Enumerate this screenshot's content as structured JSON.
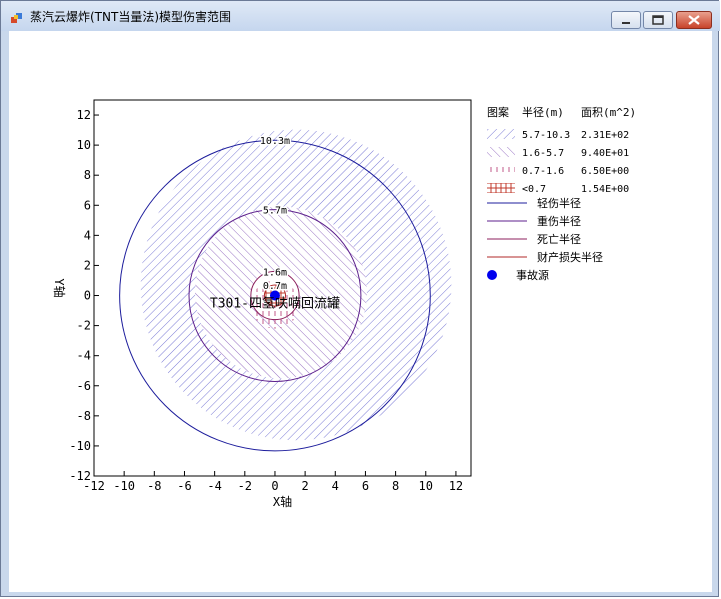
{
  "window": {
    "title": "蒸汽云爆炸(TNT当量法)模型伤害范围",
    "controls": [
      "minimize-icon",
      "maximize-icon",
      "close-icon"
    ]
  },
  "chart_data": {
    "type": "scatter",
    "xlabel": "X轴",
    "ylabel": "Y轴",
    "xlim": [
      -12,
      13
    ],
    "ylim": [
      -12,
      13
    ],
    "xticks": [
      "-12",
      "-10",
      "-8",
      "-6",
      "-4",
      "-2",
      "0",
      "2",
      "4",
      "6",
      "8",
      "10",
      "12"
    ],
    "yticks": [
      "12",
      "10",
      "8",
      "6",
      "4",
      "2",
      "0",
      "-2",
      "-4",
      "-6",
      "-8",
      "-10",
      "-12"
    ],
    "grid": false,
    "legend_position": "right",
    "circles": [
      {
        "radius": 10.3,
        "label": "10.3m",
        "series": "轻伤半径"
      },
      {
        "radius": 5.7,
        "label": "5.7m",
        "series": "重伤半径"
      },
      {
        "radius": 1.6,
        "label": "1.6m",
        "series": "死亡半径"
      },
      {
        "radius": 0.7,
        "label": "0.7m",
        "series": "财产损失半径"
      }
    ],
    "source": {
      "x": 0,
      "y": 0,
      "label": "T301-四氢呋喃回流罐"
    },
    "legend": {
      "headers": [
        "图案",
        "半径(m)",
        "面积(m^2)"
      ],
      "area_rows": [
        {
          "range": "5.7-10.3",
          "area": "2.31E+02",
          "pattern": "diag-right"
        },
        {
          "range": "1.6-5.7",
          "area": "9.40E+01",
          "pattern": "diag-left"
        },
        {
          "range": "0.7-1.6",
          "area": "6.50E+00",
          "pattern": "vertical"
        },
        {
          "range": "<0.7",
          "area": "1.54E+00",
          "pattern": "cross"
        }
      ],
      "line_rows": [
        {
          "label": "轻伤半径",
          "color": "#1c1c9c"
        },
        {
          "label": "重伤半径",
          "color": "#5c1f8c"
        },
        {
          "label": "死亡半径",
          "color": "#8c1f5c"
        },
        {
          "label": "财产损失半径",
          "color": "#b22a2a"
        }
      ],
      "source_label": "事故源"
    }
  },
  "colors": {
    "hatch_outer": "#7b7bd6",
    "hatch_inner": "#9a74c4",
    "hatch_vertical": "#c0598a",
    "hatch_cross": "#c0392b",
    "source": "#0000ee"
  }
}
